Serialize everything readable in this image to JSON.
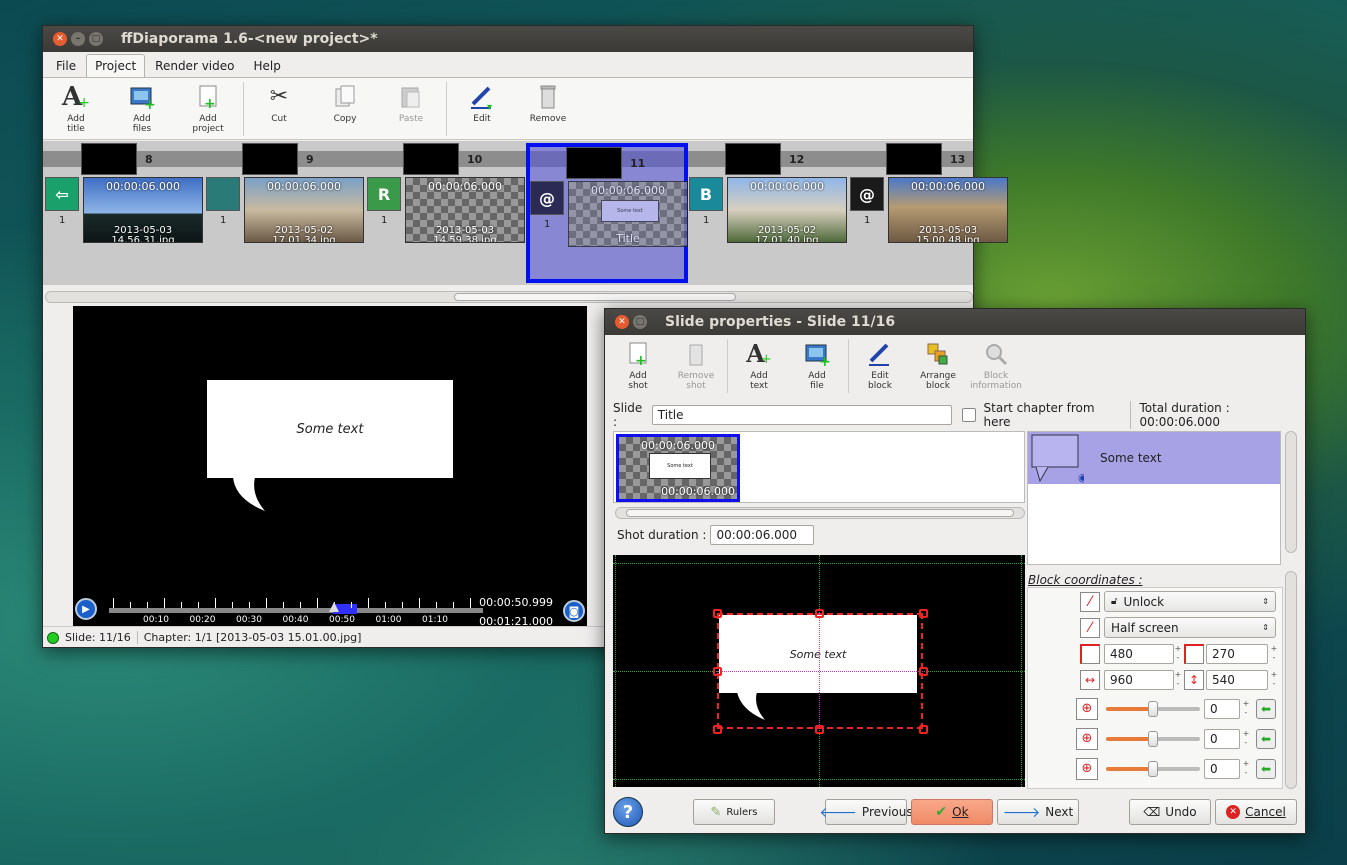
{
  "main_window": {
    "title": "ffDiaporama 1.6-<new project>*",
    "menus": [
      "File",
      "Project",
      "Render video",
      "Help"
    ],
    "active_menu": "Project",
    "toolbar": [
      {
        "label": "Add\ntitle",
        "icon": "add-title-icon"
      },
      {
        "label": "Add\nfiles",
        "icon": "add-files-icon"
      },
      {
        "label": "Add\nproject",
        "icon": "add-project-icon"
      },
      {
        "label": "Cut",
        "icon": "scissors-icon"
      },
      {
        "label": "Copy",
        "icon": "copy-icon"
      },
      {
        "label": "Paste",
        "icon": "paste-icon",
        "disabled": true
      },
      {
        "label": "Edit",
        "icon": "pen-icon"
      },
      {
        "label": "Remove",
        "icon": "trash-icon"
      }
    ],
    "timeline": {
      "slots": [
        {
          "num": "8",
          "time": "00:00:06.000",
          "file": "2013-05-03\n14.56.31.jpg",
          "trans_label": "1",
          "trans_glyph": "⇦",
          "trans_color": "#1aa06a"
        },
        {
          "num": "9",
          "time": "00:00:06.000",
          "file": "2013-05-02\n17.01.34.jpg",
          "trans_label": "1",
          "trans_glyph": "",
          "trans_color": "#2a7b78"
        },
        {
          "num": "10",
          "time": "00:00:06.000",
          "file": "2013-05-03\n14.59.38.jpg",
          "trans_label": "1",
          "trans_glyph": "R",
          "trans_color": "#3a9a4a"
        },
        {
          "num": "11",
          "time": "00:00:06.000",
          "file": "Title",
          "trans_label": "1",
          "trans_glyph": "@",
          "trans_color": "#2a2a55",
          "bubble_text": "Some text",
          "selected": true
        },
        {
          "num": "12",
          "time": "00:00:06.000",
          "file": "2013-05-02\n17.01.40.jpg",
          "trans_label": "1",
          "trans_glyph": "B",
          "trans_color": "#1a8a9a"
        },
        {
          "num": "13",
          "time": "00:00:06.000",
          "file": "2013-05-03\n15.00.48.jpg",
          "trans_label": "1",
          "trans_glyph": "@",
          "trans_color": "#1a1a1a"
        }
      ]
    },
    "preview": {
      "bubble_text": "Some text",
      "ticks": [
        "00:10",
        "00:20",
        "00:30",
        "00:40",
        "00:50",
        "01:00",
        "01:10"
      ],
      "current_time": "00:00:50.999",
      "total_time": "00:01:21.000",
      "progress": 0.62
    },
    "status": {
      "slide": "Slide: 11/16",
      "chapter": "Chapter: 1/1 [2013-05-03 15.01.00.jpg]"
    }
  },
  "dialog": {
    "title": "Slide properties - Slide 11/16",
    "toolbar": [
      {
        "label": "Add\nshot",
        "icon": "add-shot-icon"
      },
      {
        "label": "Remove\nshot",
        "icon": "remove-shot-icon",
        "disabled": true
      },
      {
        "label": "Add\ntext",
        "icon": "add-text-icon"
      },
      {
        "label": "Add\nfile",
        "icon": "add-file-icon"
      },
      {
        "label": "Edit\nblock",
        "icon": "edit-block-icon"
      },
      {
        "label": "Arrange\nblock",
        "icon": "arrange-block-icon"
      },
      {
        "label": "Block\ninformation",
        "icon": "block-info-icon",
        "disabled": true
      }
    ],
    "slide_label": "Slide :",
    "slide_name": "Title",
    "start_chapter_label": "Start chapter from here",
    "total_duration": "Total duration : 00:00:06.000",
    "shot": {
      "time_top": "00:00:06.000",
      "time_bottom": "00:00:06.000",
      "bubble_text": "Some text"
    },
    "shot_duration_label": "Shot duration :",
    "shot_duration": "00:00:06.000",
    "block_list": [
      {
        "text": "Some text"
      }
    ],
    "canvas_text": "Some text",
    "coords_title": "Block coordinates :",
    "lock_value": "Unlock",
    "size_value": "Half screen",
    "x": "480",
    "y": "270",
    "w": "960",
    "h": "540",
    "rotations": [
      "0",
      "0",
      "0"
    ],
    "buttons": {
      "rulers": "Rulers",
      "previous": "Previous",
      "ok": "Ok",
      "next": "Next",
      "undo": "Undo",
      "cancel": "Cancel"
    }
  }
}
